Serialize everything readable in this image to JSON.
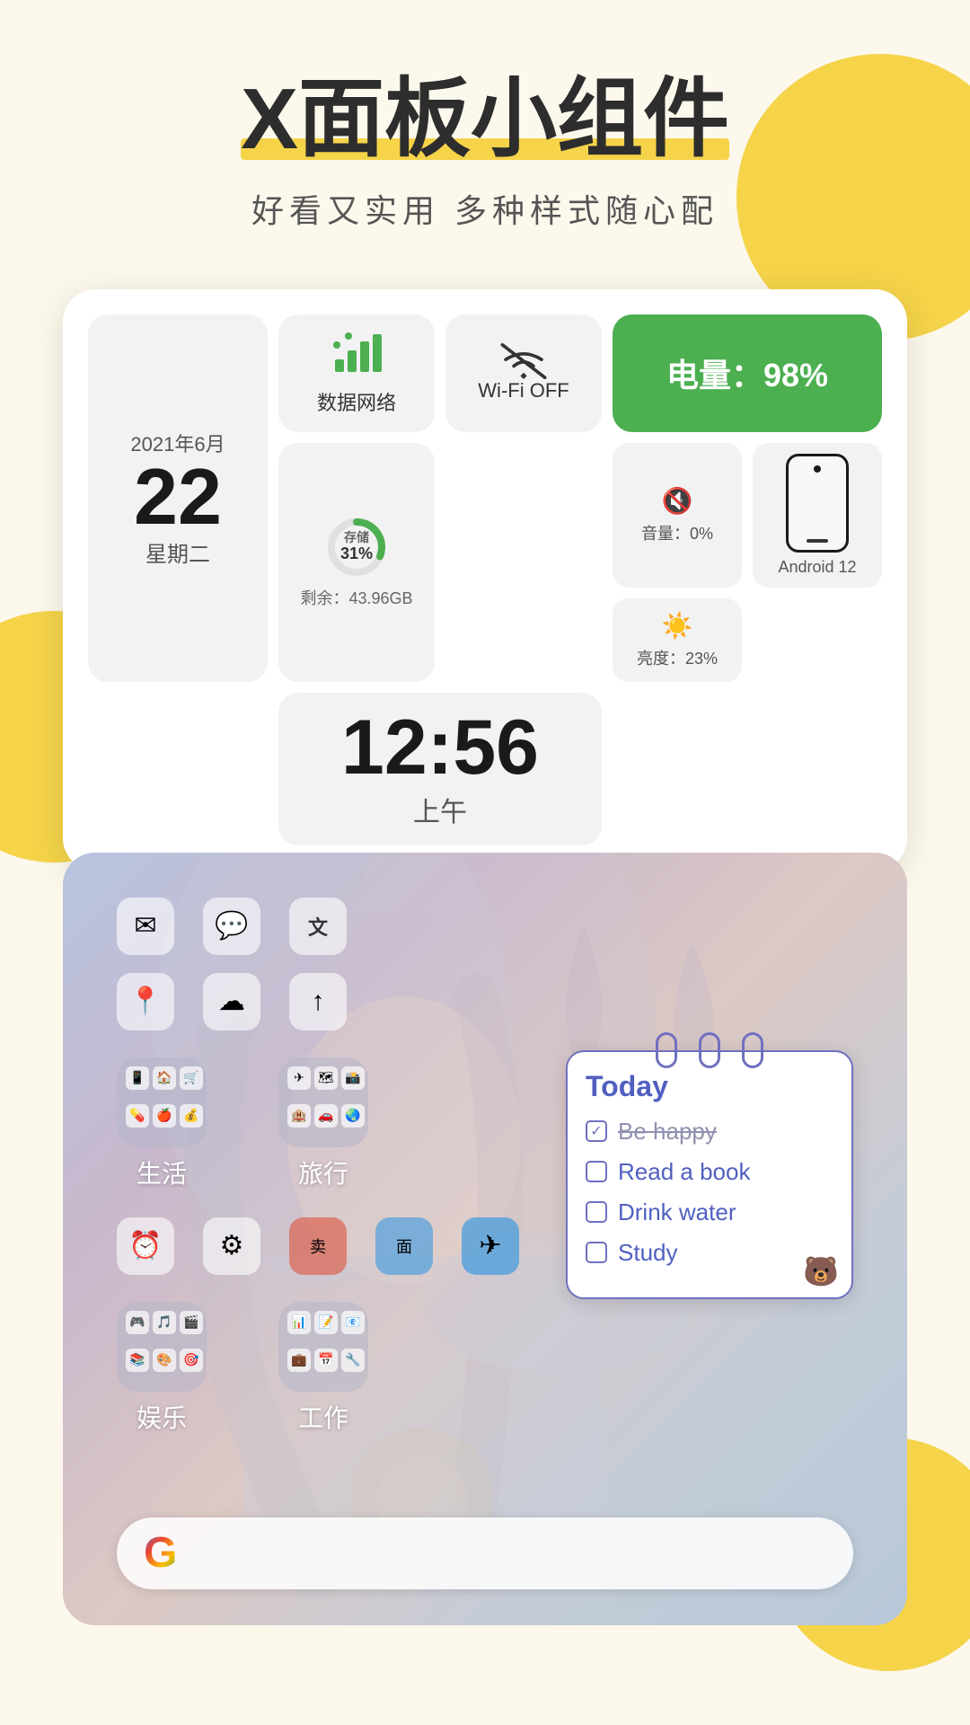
{
  "page": {
    "bg_color": "#fdf8ec",
    "accent_yellow": "#f5d44a",
    "accent_green": "#4CAF50",
    "accent_blue": "#7070c0"
  },
  "header": {
    "title": "X面板小组件",
    "subtitle": "好看又实用  多种样式随心配"
  },
  "widget": {
    "date": {
      "year_month": "2021年6月",
      "day": "22",
      "weekday": "星期二"
    },
    "data_network": {
      "label": "数据网络"
    },
    "wifi": {
      "label": "Wi-Fi OFF"
    },
    "battery": {
      "label": "电量：98%"
    },
    "storage": {
      "percent_label": "存储",
      "percent": "31%",
      "remaining": "剩余：43.96GB",
      "circle_value": 31
    },
    "clock": {
      "time": "12:56",
      "ampm": "上午"
    },
    "volume": {
      "label": "音量：0%"
    },
    "brightness": {
      "label": "亮度：23%"
    },
    "phone_widget": {
      "label": "Android 12"
    }
  },
  "phone_screen": {
    "app_row1": [
      "✉",
      "✉",
      "文"
    ],
    "app_row2": [
      "📍",
      "☁",
      "↑"
    ],
    "folder1_label": "生活",
    "folder2_label": "旅行",
    "app_row3": [
      "⏰",
      "⚙",
      "卖",
      "面",
      "✈"
    ],
    "folder3_label": "娱乐",
    "folder4_label": "工作",
    "google_label": "G"
  },
  "todo": {
    "title": "Today",
    "items": [
      {
        "text": "Be happy",
        "checked": true,
        "strikethrough": true
      },
      {
        "text": "Read a book",
        "checked": false,
        "strikethrough": false
      },
      {
        "text": "Drink water",
        "checked": false,
        "strikethrough": false
      },
      {
        "text": "Study",
        "checked": false,
        "strikethrough": false
      }
    ]
  }
}
